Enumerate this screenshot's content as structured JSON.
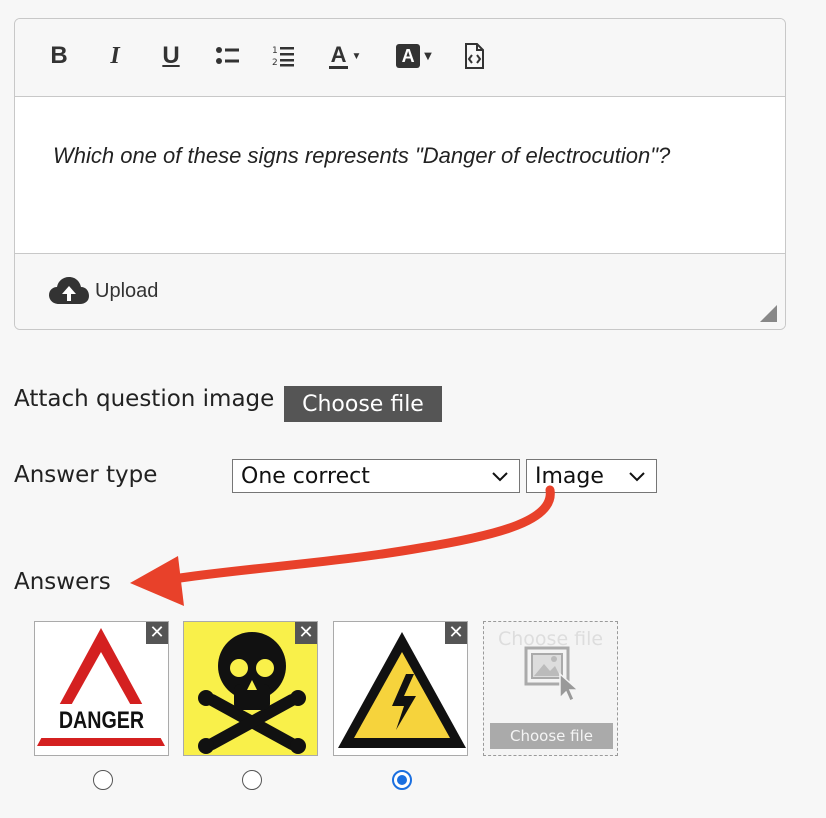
{
  "editor": {
    "toolbar": {
      "bold": "B",
      "italic": "I",
      "underline": "U",
      "bulleted_list": "bulleted-list-icon",
      "numbered_list": "numbered-list-icon",
      "font_color": "A",
      "background_color": "A",
      "source": "source-code-icon"
    },
    "question_text": "Which one of these signs represents \"Danger of electrocution\"?",
    "upload_label": "Upload"
  },
  "attach": {
    "label": "Attach question image",
    "button": "Choose file"
  },
  "answer_type": {
    "label": "Answer type",
    "mode_value": "One correct",
    "format_value": "Image"
  },
  "answers": {
    "heading": "Answers",
    "items": [
      {
        "image": "danger-sign-image",
        "text": "DANGER",
        "selected": false
      },
      {
        "image": "skull-crossbones-image",
        "selected": false
      },
      {
        "image": "electrical-hazard-image",
        "selected": true
      }
    ],
    "new_slot": {
      "ghost": "Choose file",
      "button": "Choose file"
    }
  },
  "colors": {
    "accent_arrow": "#e8412a",
    "radio_selected": "#1a6fe0",
    "button_dark": "#555555"
  }
}
